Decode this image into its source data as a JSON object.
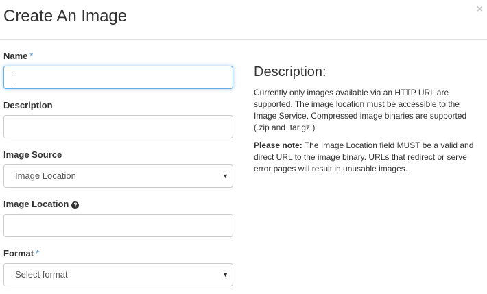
{
  "modal": {
    "title": "Create An Image",
    "close_glyph": "×"
  },
  "form": {
    "name": {
      "label": "Name",
      "required_mark": "*",
      "value": ""
    },
    "description": {
      "label": "Description",
      "value": ""
    },
    "image_source": {
      "label": "Image Source",
      "selected": "Image Location"
    },
    "image_location": {
      "label": "Image Location",
      "help_icon": "question-circle-icon",
      "help_glyph": "?",
      "value": ""
    },
    "format": {
      "label": "Format",
      "required_mark": "*",
      "selected": "Select format"
    },
    "select_arrow": "▼"
  },
  "help": {
    "title": "Description:",
    "paragraph1": "Currently only images available via an HTTP URL are supported. The image location must be accessible to the Image Service. Compressed image binaries are supported (.zip and .tar.gz.)",
    "note_label": "Please note:",
    "note_text": " The Image Location field MUST be a valid and direct URL to the image binary. URLs that redirect or serve error pages will result in unusable images."
  },
  "colors": {
    "required": "#428bca",
    "focus_border": "#66afe9",
    "border": "#cccccc",
    "close": "#c8c8c8"
  }
}
